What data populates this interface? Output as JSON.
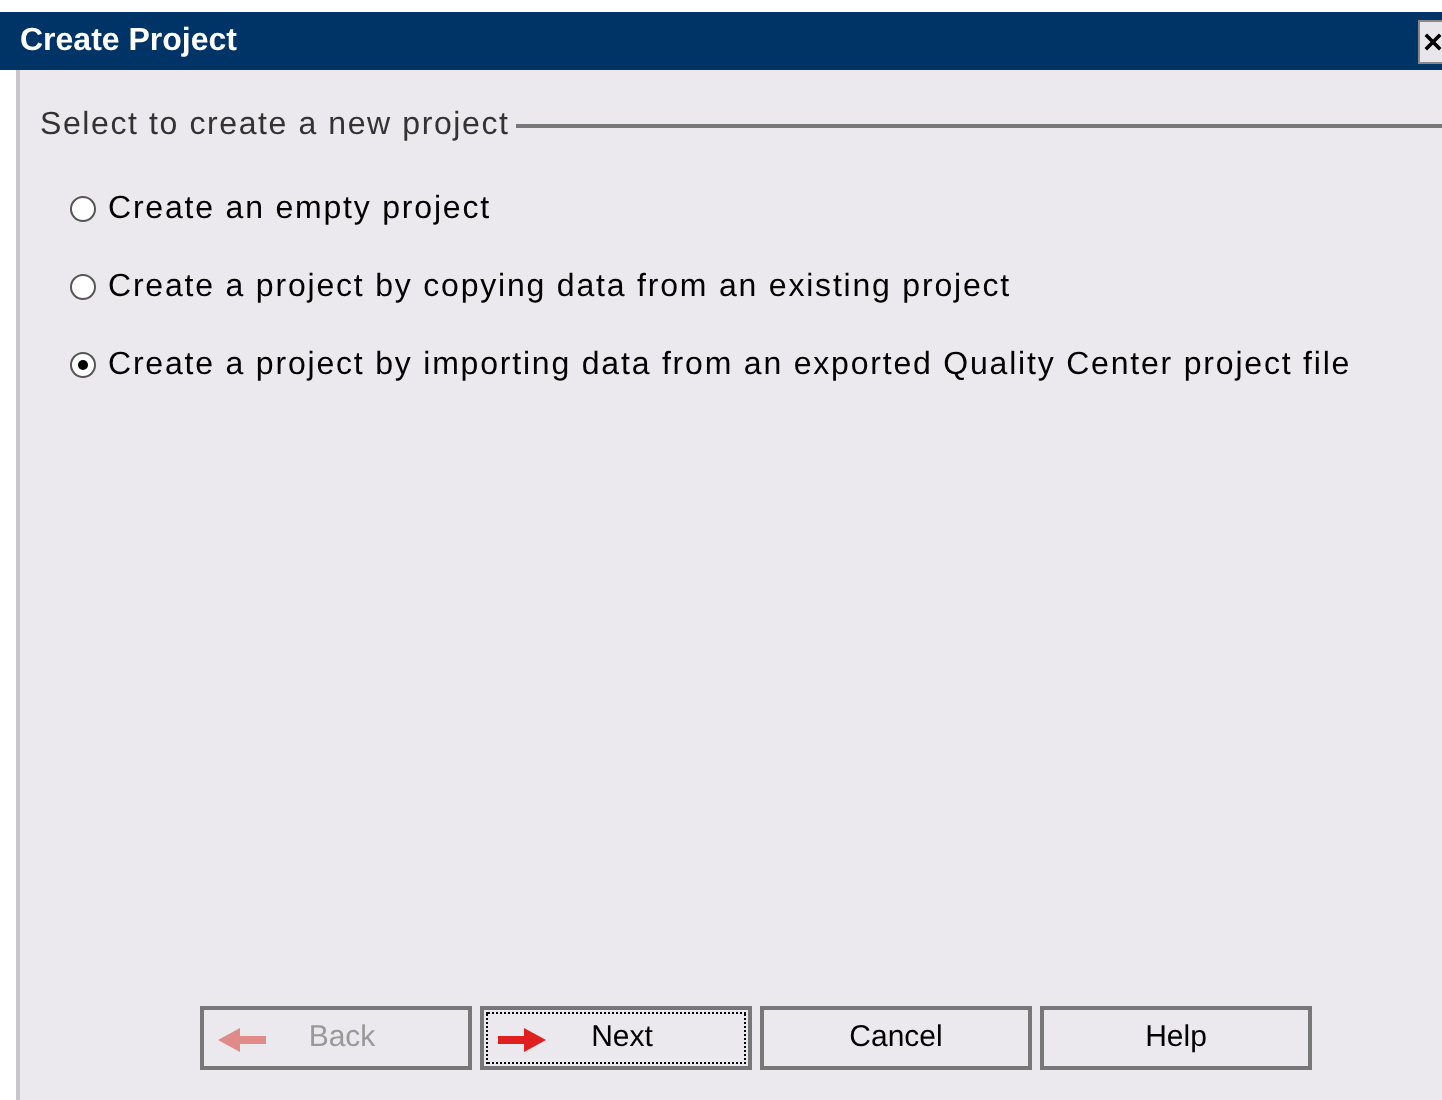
{
  "window": {
    "title": "Create Project"
  },
  "group": {
    "title": "Select to create a new project"
  },
  "options": [
    {
      "label": "Create an empty project",
      "selected": false
    },
    {
      "label": "Create a project by copying data from an existing project",
      "selected": false
    },
    {
      "label": "Create a project by importing data from an exported Quality Center project file",
      "selected": true
    }
  ],
  "buttons": [
    {
      "label": "Back",
      "kind": "back",
      "disabled": true,
      "focused": false
    },
    {
      "label": "Next",
      "kind": "forward",
      "disabled": false,
      "focused": true
    },
    {
      "label": "Cancel",
      "kind": "plain",
      "disabled": false,
      "focused": false
    },
    {
      "label": "Help",
      "kind": "plain",
      "disabled": false,
      "focused": false
    }
  ]
}
